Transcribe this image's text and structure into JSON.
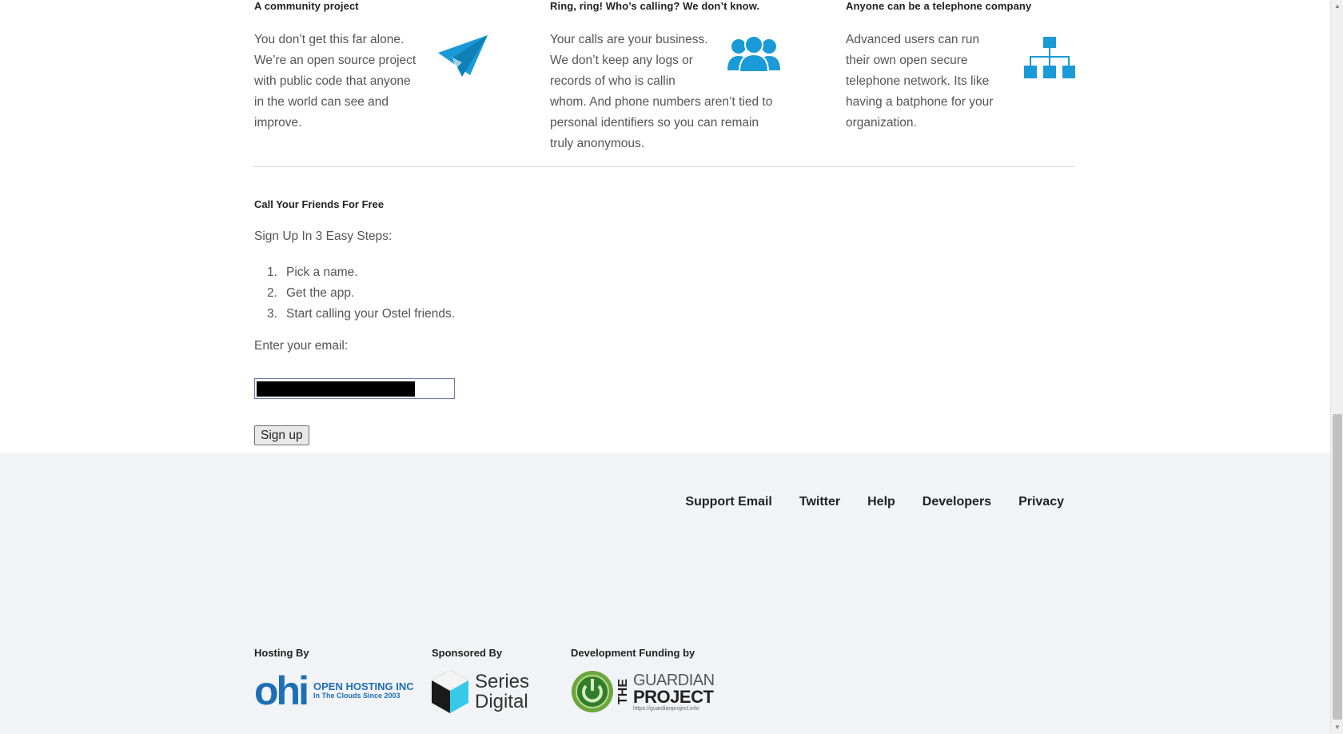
{
  "features": [
    {
      "title": "A community project",
      "text": "You don’t get this far alone. We’re an open source project with public code that anyone in the world can see and improve.",
      "icon": "paper-plane-icon"
    },
    {
      "title": "Ring, ring! Who’s calling? We don’t know.",
      "text_lines": [
        "Your calls are your business.",
        "We don’t keep any logs or",
        "records of who is callin",
        "whom. And phone numbers aren’t tied to",
        "personal identifiers so you can remain",
        "truly anonymous."
      ],
      "icon": "users-icon"
    },
    {
      "title": "Anyone can be a telephone company",
      "text": "Advanced users can run their own open secure telephone network. Its like having a batphone for your organization.",
      "icon": "network-icon"
    }
  ],
  "signup": {
    "title": "Call Your Friends For Free",
    "intro": "Sign Up In 3 Easy Steps:",
    "steps": [
      "Pick a name.",
      "Get the app.",
      "Start calling your Ostel friends."
    ],
    "email_label": "Enter your email:",
    "button_label": "Sign up"
  },
  "footer": {
    "nav": [
      "Support Email",
      "Twitter",
      "Help",
      "Developers",
      "Privacy"
    ],
    "hosting_label": "Hosting By",
    "hosting_logo": {
      "mark": "ohi",
      "name": "OPEN HOSTING INC",
      "tagline": "In The Clouds Since 2003"
    },
    "sponsor_label": "Sponsored By",
    "sponsor_logo": {
      "line1": "Series",
      "line2": "Digital"
    },
    "funding_label": "Development Funding by",
    "funding_logo": {
      "the": "THE",
      "line1": "GUARDIAN",
      "line2": "PROJECT",
      "url": "https://guardianproject.info"
    }
  },
  "colors": {
    "accent": "#1a9ad6",
    "footer_bg": "#f2f3f6",
    "ohi_blue": "#1d6fb5"
  }
}
